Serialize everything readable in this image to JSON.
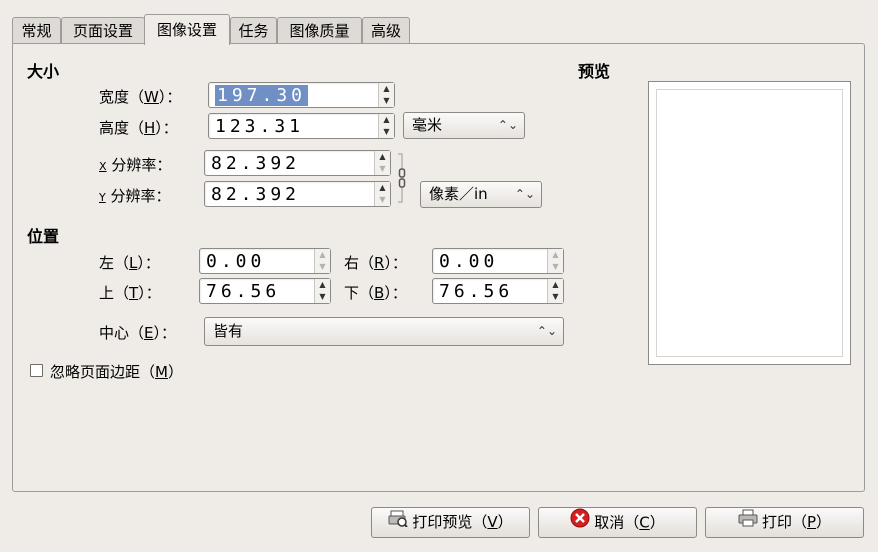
{
  "tabs": [
    "常规",
    "页面设置",
    "图像设置",
    "任务",
    "图像质量",
    "高级"
  ],
  "active_tab": 2,
  "size": {
    "heading": "大小",
    "width_label": "宽度（",
    "width_key": "W",
    "width_label_end": "）：",
    "width_value": "197.30",
    "height_label": "高度（",
    "height_key": "H",
    "height_label_end": "）：",
    "height_value": "123.31",
    "unit_select": "毫米",
    "x_res_key": "X",
    "x_res_label": " 分辨率：",
    "x_res_value": "82.392",
    "y_res_key": "Y",
    "y_res_label": " 分辨率：",
    "y_res_value": "82.392",
    "res_unit_select": "像素／in"
  },
  "position": {
    "heading": "位置",
    "left_label": "左（",
    "left_key": "L",
    "left_end": "）：",
    "left_value": "0.00",
    "right_label": "右（",
    "right_key": "R",
    "right_end": "）：",
    "right_value": "0.00",
    "top_label": "上（",
    "top_key": "T",
    "top_end": "）：",
    "top_value": "76.56",
    "bottom_label": "下（",
    "bottom_key": "B",
    "bottom_end": "）：",
    "bottom_value": "76.56",
    "center_label": "中心（",
    "center_key": "E",
    "center_end": "）：",
    "center_value": "皆有"
  },
  "ignore_margins": {
    "label": "忽略页面边距（",
    "key": "M",
    "end": "）",
    "checked": false
  },
  "preview": {
    "heading": "预览"
  },
  "buttons": {
    "print_preview": "打印预览（",
    "print_preview_key": "V",
    "print_preview_end": "）",
    "cancel": "取消（",
    "cancel_key": "C",
    "cancel_end": "）",
    "print": "打印（",
    "print_key": "P",
    "print_end": "）"
  }
}
